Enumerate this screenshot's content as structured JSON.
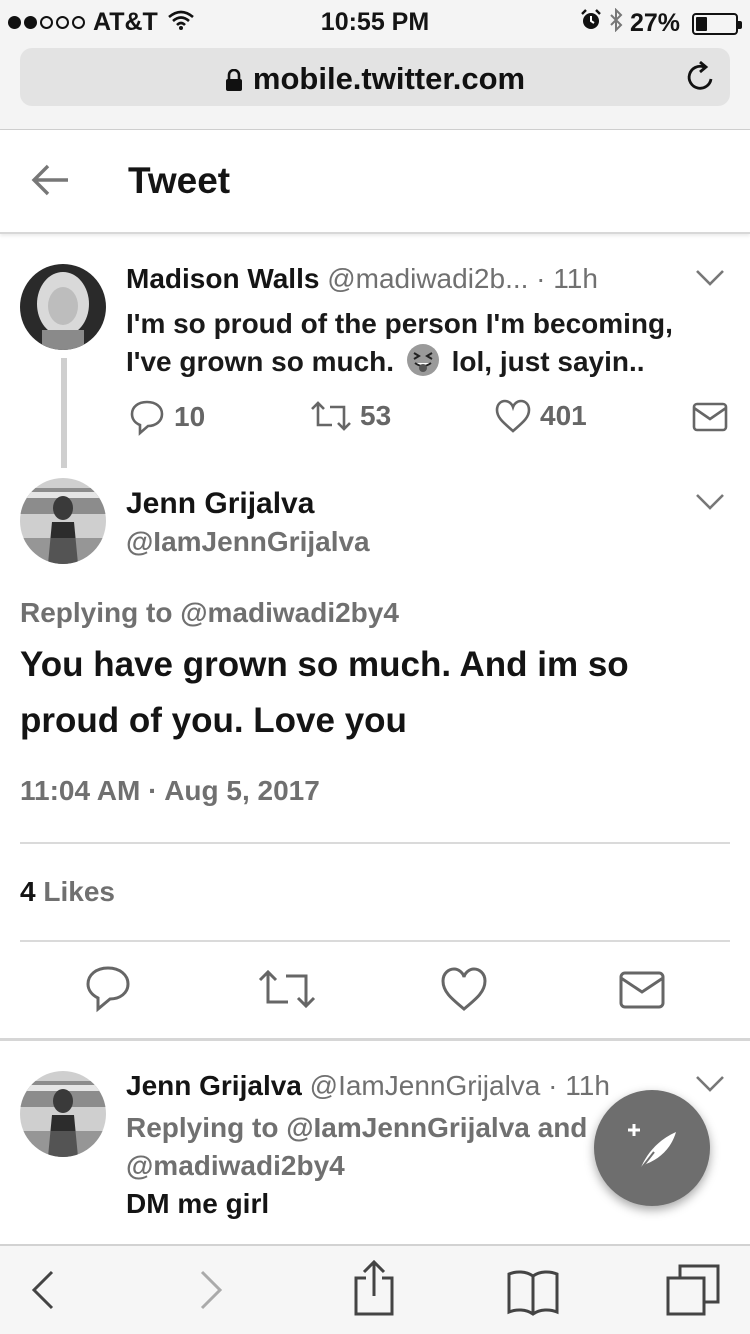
{
  "status_bar": {
    "carrier": "AT&T",
    "time": "10:55 PM",
    "battery": "27%",
    "battery_level": 0.27,
    "signal_bars_filled": 2,
    "signal_bars_total": 5
  },
  "browser": {
    "url": "mobile.twitter.com"
  },
  "header": {
    "title": "Tweet"
  },
  "parent_tweet": {
    "author_name": "Madison Walls",
    "author_handle": "@madiwadi2b...",
    "separator": " · ",
    "age": "11h",
    "text_part1": "I'm so proud of the person I'm becoming, I've grown so much.",
    "text_part2": "lol, just sayin..",
    "replies": "10",
    "retweets": "53",
    "likes": "401"
  },
  "main_tweet": {
    "author_name": "Jenn Grijalva",
    "author_handle": "@IamJennGrijalva",
    "replying_to": "Replying to @madiwadi2by4",
    "text": "You have grown so much. And im so proud of you. Love you",
    "timestamp": "11:04 AM · Aug 5, 2017",
    "likes_count": "4",
    "likes_label": "Likes"
  },
  "reply_tweet": {
    "author_name": "Jenn Grijalva",
    "author_handle": "@IamJennGrijalva",
    "separator": " · ",
    "age": "11h",
    "replying_line1": "Replying to @IamJennGrijalva and",
    "replying_line2": "@madiwadi2by4",
    "text": "DM me girl"
  },
  "icons": {
    "status": [
      "signal-dots",
      "wifi-icon",
      "alarm-icon",
      "bluetooth-icon",
      "battery-icon"
    ],
    "browser": [
      "lock-icon",
      "reload-icon"
    ],
    "tweet_actions": [
      "reply-icon",
      "retweet-icon",
      "like-icon",
      "direct-message-icon"
    ],
    "toolbar": [
      "back-icon",
      "forward-icon",
      "share-icon",
      "bookmarks-icon",
      "tabs-icon"
    ],
    "fab": "compose-tweet-icon"
  }
}
